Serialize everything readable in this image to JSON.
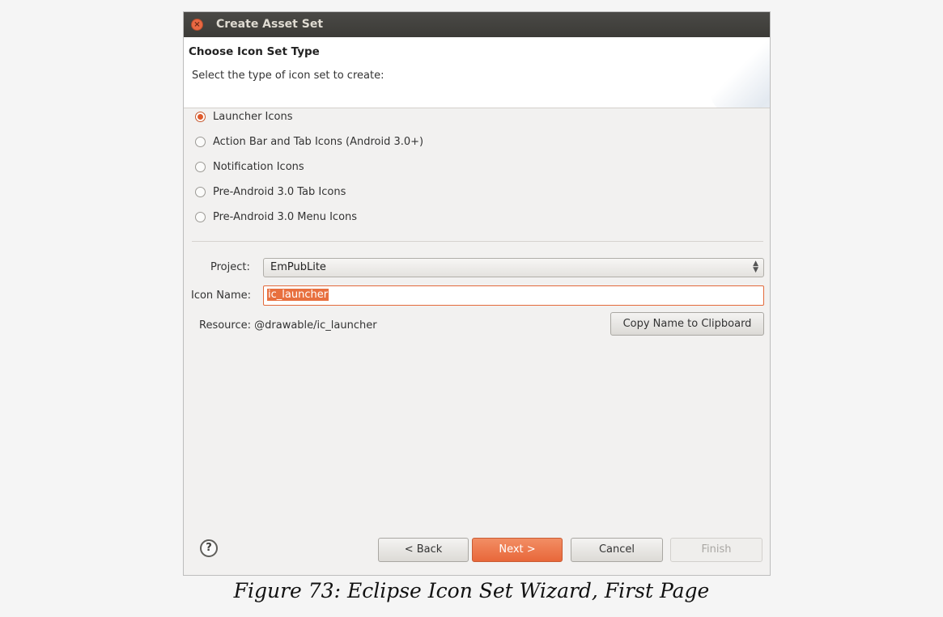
{
  "window": {
    "title": "Create Asset Set"
  },
  "header": {
    "title": "Choose Icon Set Type",
    "description": "Select the type of icon set to create:"
  },
  "icon_types": [
    {
      "label": "Launcher Icons",
      "selected": true
    },
    {
      "label": "Action Bar and Tab Icons (Android 3.0+)",
      "selected": false
    },
    {
      "label": "Notification Icons",
      "selected": false
    },
    {
      "label": "Pre-Android 3.0 Tab Icons",
      "selected": false
    },
    {
      "label": "Pre-Android 3.0 Menu Icons",
      "selected": false
    }
  ],
  "form": {
    "project_label": "Project:",
    "project_value": "EmPubLite",
    "icon_name_label": "Icon Name:",
    "icon_name_value": "ic_launcher",
    "resource_label": "Resource: @drawable/ic_launcher",
    "copy_button": "Copy Name to Clipboard"
  },
  "buttons": {
    "back": "< Back",
    "next": "Next >",
    "cancel": "Cancel",
    "finish": "Finish"
  },
  "help_glyph": "?",
  "close_glyph": "×",
  "caption": "Figure 73: Eclipse Icon Set Wizard, First Page",
  "colors": {
    "accent": "#e8673a",
    "titlebar": "#3c3b37"
  }
}
